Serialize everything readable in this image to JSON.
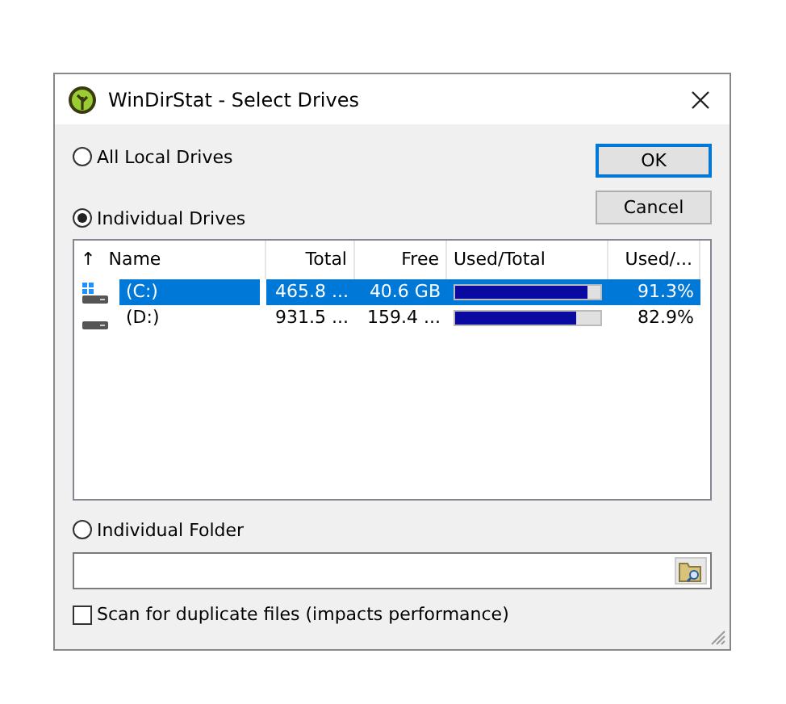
{
  "window": {
    "title": "WinDirStat - Select Drives"
  },
  "options": [
    {
      "label": "All Local Drives",
      "selected": false
    },
    {
      "label": "Individual Drives",
      "selected": true
    }
  ],
  "buttons": [
    "OK",
    "Cancel"
  ],
  "table": {
    "columns": [
      {
        "label": "Name",
        "sorted": true
      },
      {
        "label": "Total",
        "sorted": false
      },
      {
        "label": "Free",
        "sorted": false
      },
      {
        "label": "Used/Total",
        "sorted": false
      },
      {
        "label": "Used/...",
        "sorted": false
      }
    ],
    "sort_arrow": "↑",
    "rows": [
      {
        "name": "(C:)",
        "kind": "system",
        "total": "465.8 ...",
        "free": "40.6 GB",
        "level": 0.913,
        "percent": "91.3%",
        "selected": true
      },
      {
        "name": "(D:)",
        "kind": "disk",
        "total": "931.5 ...",
        "free": "159.4 ...",
        "level": 0.829,
        "percent": "82.9%",
        "selected": false
      }
    ]
  },
  "folder_option": {
    "label": "Individual Folder",
    "selected": false
  },
  "duplicates": {
    "label": "Scan for duplicate files (impacts performance)",
    "checked": false
  }
}
